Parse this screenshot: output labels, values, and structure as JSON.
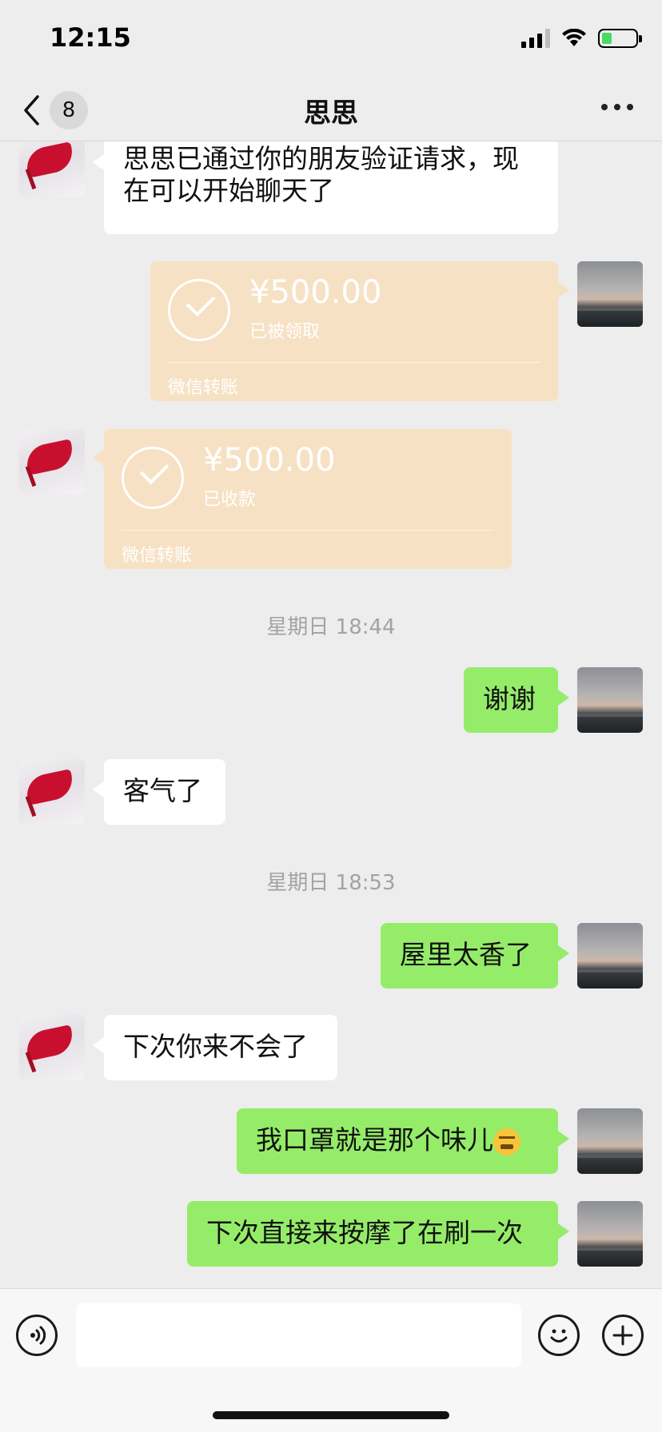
{
  "status_bar": {
    "time": "12:15",
    "battery_level": 0.3,
    "battery_color": "#4cd964"
  },
  "nav": {
    "back_icon": "chevron-left-icon",
    "unread_count": "8",
    "title": "思思",
    "more_icon": "ellipsis-icon"
  },
  "messages": {
    "m1": {
      "side": "left",
      "text": "思思已通过你的朋友验证请求，现在可以开始聊天了"
    },
    "m2": {
      "side": "right",
      "type": "transfer",
      "amount": "¥500.00",
      "status": "已被领取",
      "label": "微信转账"
    },
    "m3": {
      "side": "left",
      "type": "transfer",
      "amount": "¥500.00",
      "status": "已收款",
      "label": "微信转账"
    },
    "t1": "星期日 18:44",
    "m4": {
      "side": "right",
      "text": "谢谢"
    },
    "m5": {
      "side": "left",
      "text": "客气了"
    },
    "t2": "星期日 18:53",
    "m6": {
      "side": "right",
      "text": "屋里太香了"
    },
    "m7": {
      "side": "left",
      "text": "下次你来不会了"
    },
    "m8": {
      "side": "right",
      "text": "我口罩就是那个味儿",
      "emoji": "persevering-face-emoji"
    },
    "m9": {
      "side": "right",
      "text": "下次直接来按摩了在刷一次"
    }
  },
  "colors": {
    "sent_bubble": "#95ec69",
    "received_bubble": "#ffffff",
    "transfer_card": "#f7e1c4",
    "background": "#ededed"
  },
  "input_bar": {
    "voice_icon": "voice-icon",
    "emoji_icon": "smiley-icon",
    "plus_icon": "plus-icon",
    "placeholder": ""
  }
}
